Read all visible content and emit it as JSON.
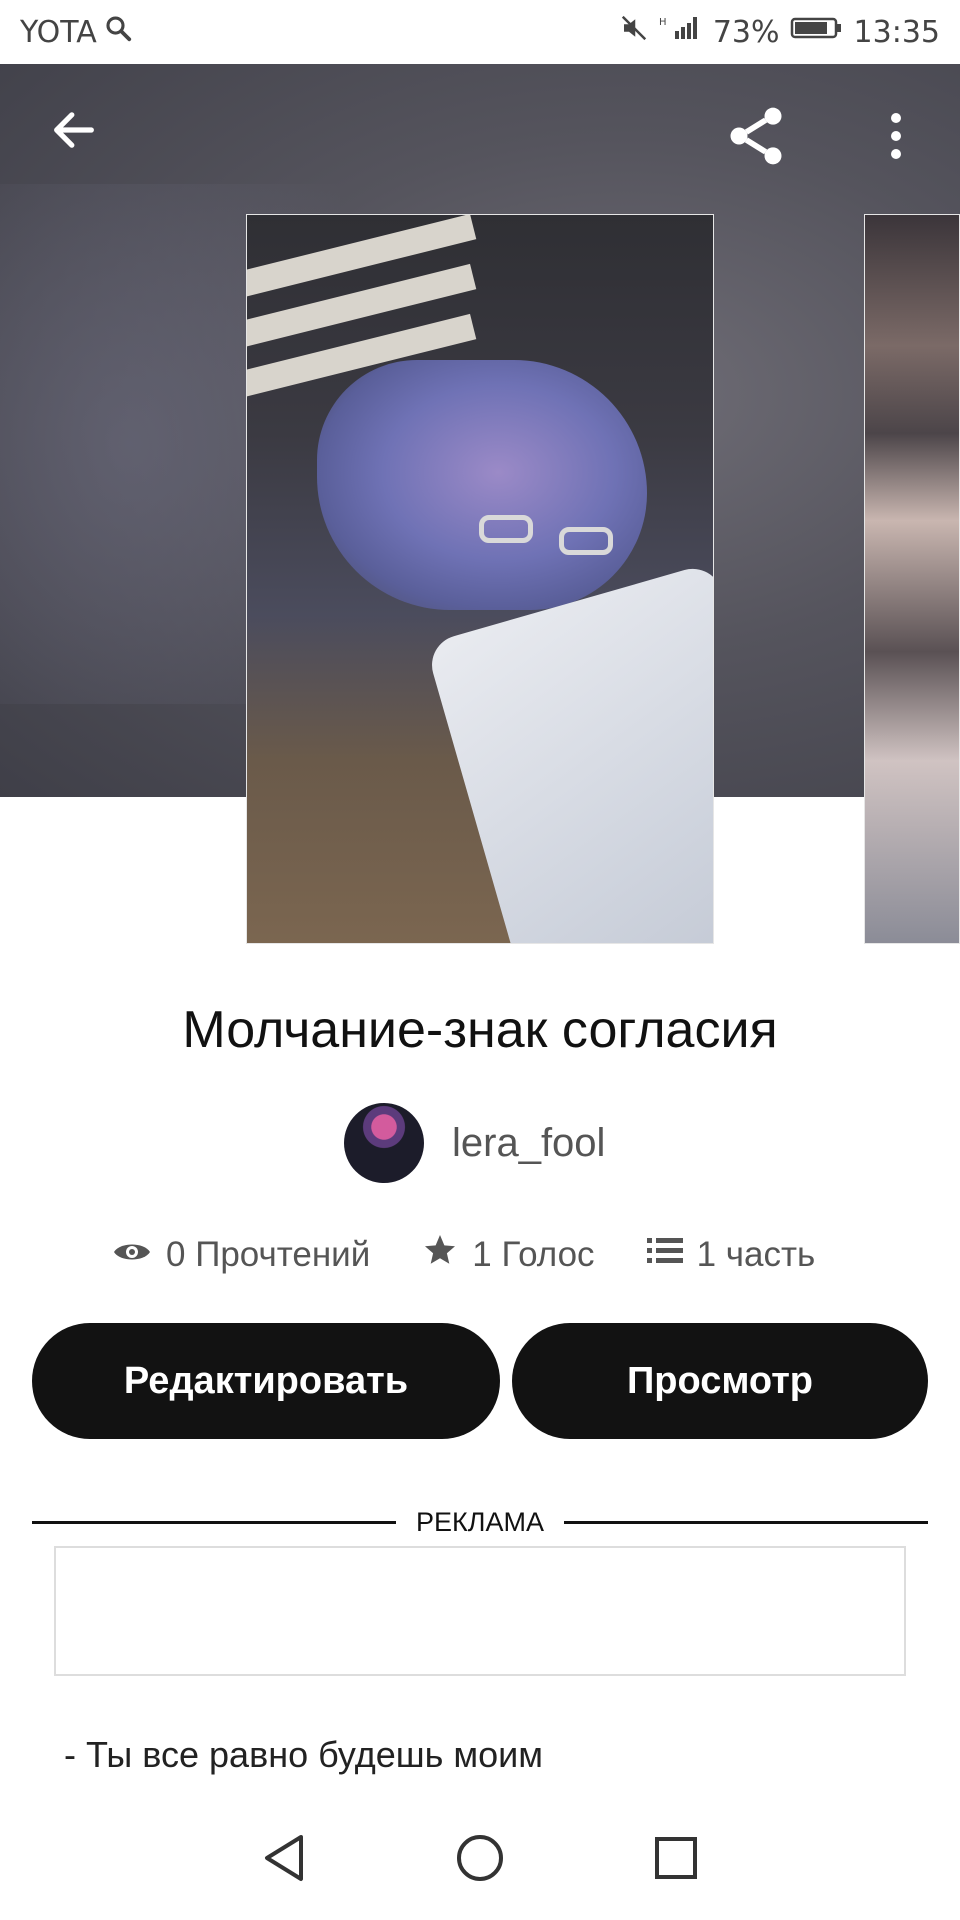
{
  "status": {
    "carrier": "YOTA",
    "battery": "73%",
    "time": "13:35"
  },
  "toolbar": {
    "icons": [
      "arrow-left-icon",
      "share-icon",
      "more-vertical-icon"
    ]
  },
  "story": {
    "title": "Молчание-знак согласия",
    "author": "lera_fool",
    "stats": {
      "reads": "0 Прочтений",
      "votes": "1 Голос",
      "parts": "1 часть"
    }
  },
  "actions": {
    "edit_label": "Редактировать",
    "view_label": "Просмотр"
  },
  "ad": {
    "label": "РЕКЛАМА"
  },
  "excerpt": "- Ты все равно будешь моим",
  "colors": {
    "button_bg": "#121212",
    "button_text": "#ffffff",
    "hero_bg": "#55545d"
  }
}
